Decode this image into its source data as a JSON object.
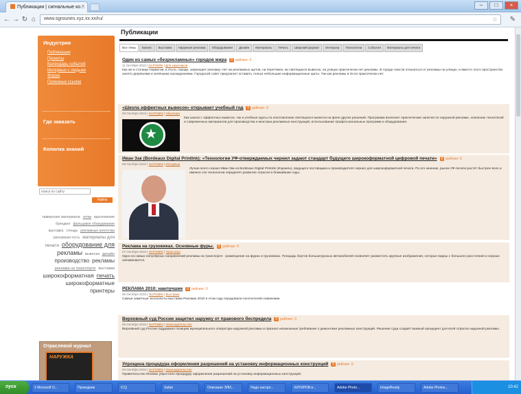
{
  "browser": {
    "tab_title": "Публикации | сигнальные ко...",
    "url": "www.sgrounes.xyz.xx.xx/ru/",
    "tab_close": "×",
    "back_icon": "←",
    "forward_icon": "→",
    "reload_icon": "↻",
    "home_icon": "⌂",
    "star_icon": "☆",
    "menu_icon": "✎",
    "minimize": "–",
    "maximize": "□",
    "close": "×"
  },
  "sidebar": {
    "menu": [
      {
        "label": "Индустрия",
        "sub": [
          "Публикации",
          "Проекты",
          "Календарь событий",
          "Интервью с людьми",
          "Форум",
          "Полезные ссылки"
        ]
      },
      {
        "label": "Где заказать",
        "sub": []
      },
      {
        "label": "Копилка знаний",
        "sub": []
      }
    ],
    "search_placeholder": "поиск по сайту",
    "search_button": "Найти",
    "tags": [
      {
        "text": "тамерских материала",
        "size": 5.5
      },
      {
        "text": "сетки",
        "size": 5
      },
      {
        "text": "вдохновение",
        "size": 5
      },
      {
        "text": "брендинг",
        "size": 5
      },
      {
        "text": "фальцовое оборудование",
        "size": 5
      },
      {
        "text": "выставка",
        "size": 5
      },
      {
        "text": "стенды",
        "size": 5
      },
      {
        "text": "рекламные агентства",
        "size": 5
      },
      {
        "text": "рекламная гость",
        "size": 5
      },
      {
        "text": "материалы для печати",
        "size": 6.5
      },
      {
        "text": "оборудование для",
        "size": 9
      },
      {
        "text": "рекламы",
        "size": 9
      },
      {
        "text": "вывеска",
        "size": 5.5
      },
      {
        "text": "дизайн",
        "size": 5.5
      },
      {
        "text": "производство",
        "size": 8
      },
      {
        "text": "рекламы",
        "size": 8
      },
      {
        "text": "реклама на транспорте",
        "size": 5.5
      },
      {
        "text": "выставки",
        "size": 5.5
      },
      {
        "text": "широкоформатная",
        "size": 8.5
      },
      {
        "text": "печать",
        "size": 8.5
      },
      {
        "text": "широкоформатные",
        "size": 8
      },
      {
        "text": "принтеры",
        "size": 8
      }
    ],
    "journal_title": "Отраслевой журнал",
    "journal_logo": "НАРУЖКА"
  },
  "main": {
    "heading": "Публикации",
    "subtabs": [
      "Все темы",
      "Бизнес",
      "Выставки",
      "Наружная реклама",
      "Оборудование",
      "Дизайн",
      "Материалы",
      "Печать",
      "Широкий формат",
      "Интерьер",
      "Технологии",
      "События",
      "Материалы для печати"
    ],
    "articles": [
      {
        "title": "Один из самых «безрекламных» городов мира",
        "comments": "0",
        "rating": "рейтинг: 0",
        "meta_date": "11 Октября 2010",
        "meta_author": "NAPOMNI",
        "meta_rubric": "Для заказчиков",
        "body": "Как же в столице Норвегии, в Осло, городе, запрещает рекламу. Нет ни рекламных щитов, ни перетяжек, ни светящихся вывесок, на улицах практически нет рекламы. В городе смогли отказаться от рекламы на улицах, и вместо этого пространство занято деревьями и зелёными насаждениями. Городской совет предлагает оставить только небольшие информационные щиты. Так как рекламы в Осло практически нет."
      },
      {
        "title": "«Школа эффектных вывесок» открывает учебный год",
        "comments": "0",
        "rating": "рейтинг: 0",
        "meta_date": "08 Октября 2010",
        "meta_author": "NAPOMNI",
        "meta_rubric": "Обучение",
        "body": "Как школа с эффектных вывесок, так и учебные курсы по изготовлению светящихся вывесок на фоне других решений. Программа включает практические занятия по наружной рекламе, освоению технологий и современных материалов для производства и монтажа рекламных конструкций, использование профессиональных программ и оборудования."
      },
      {
        "title": "Иван Зак (Bordeaux Digital PrintInk): «Технологии УФ-отверждаемых чернил задают стандарт будущего широкоформатной цифровой печати»",
        "comments": "0",
        "rating": "рейтинг: 0",
        "meta_date": "08 Октября 2010",
        "meta_author": "NAPOMNI",
        "meta_rubric": "Интервью",
        "body": "Лучше всего сказал Иван Зак из Bordeaux Digital PrintInk (Израиль), ведущего поставщика и производителя чернил для широкоформатной печати. По его мнению, рынок УФ-печати растёт быстрее всех и именно эти технологии определят развитие отрасли в ближайшие годы."
      },
      {
        "title": "Реклама на грузовиках. Основные фуры.",
        "comments": "0",
        "rating": "рейтинг: 0",
        "meta_date": "07 Октября 2010",
        "meta_author": "NAPOMNI",
        "meta_rubric": "Транспорт",
        "body": "Одно из самых популярных направлений рекламы на транспорте - размещение на фурах и грузовиках. Площадь бортов большегрузных автомобилей позволяет разместить крупные изображения, которые видны с большого расстояния и хорошо запоминаются."
      },
      {
        "title": "РЕКЛАМА 2010: наилучшие",
        "comments": "0",
        "rating": "рейтинг: 0",
        "meta_date": "06 Октября 2010",
        "meta_author": "NAPOMNI",
        "meta_rubric": "Выставки",
        "body": "Самые заметные экспоненты выставки Реклама 2010 в этом году порадовали посетителей новинками."
      },
      {
        "title": "Верховный суд России защитил наружку от правового беспредела",
        "comments": "0",
        "rating": "рейтинг: 0",
        "meta_date": "05 Октября 2010",
        "meta_author": "NAPOMNI",
        "meta_rubric": "Законодательство",
        "body": "Верховный суд России поддержал позицию муниципального оператора наружной рекламы и признал незаконным требование о демонтаже рекламных конструкций. Решение суда создаёт важный прецедент для всей отрасли наружной рекламы."
      },
      {
        "title": "Упрощена процедура оформления разрешений на установку информационных конструкций",
        "comments": "0",
        "rating": "рейтинг: 0",
        "meta_date": "04 Октября 2010",
        "meta_author": "NAPOMNI",
        "meta_rubric": "Законодательство",
        "body": "Правительство Москвы упростило процедуру оформления разрешений на установку информационных конструкций."
      }
    ]
  },
  "taskbar": {
    "start": "пуск",
    "tasks": [
      "2 Microsoft O...",
      "Проводник",
      "ICQ",
      "Safari",
      "Описание ЭЛИ...",
      "Надо настро...",
      "ХИТИРОВ в...",
      "Adobe Photo...",
      "ImageReady",
      "Adobe Photos..."
    ],
    "clock": "10:42"
  },
  "colors": {
    "accent": "#E87A2A",
    "article_bg": "#F5EBE0",
    "taskbar": "#245FD0"
  }
}
